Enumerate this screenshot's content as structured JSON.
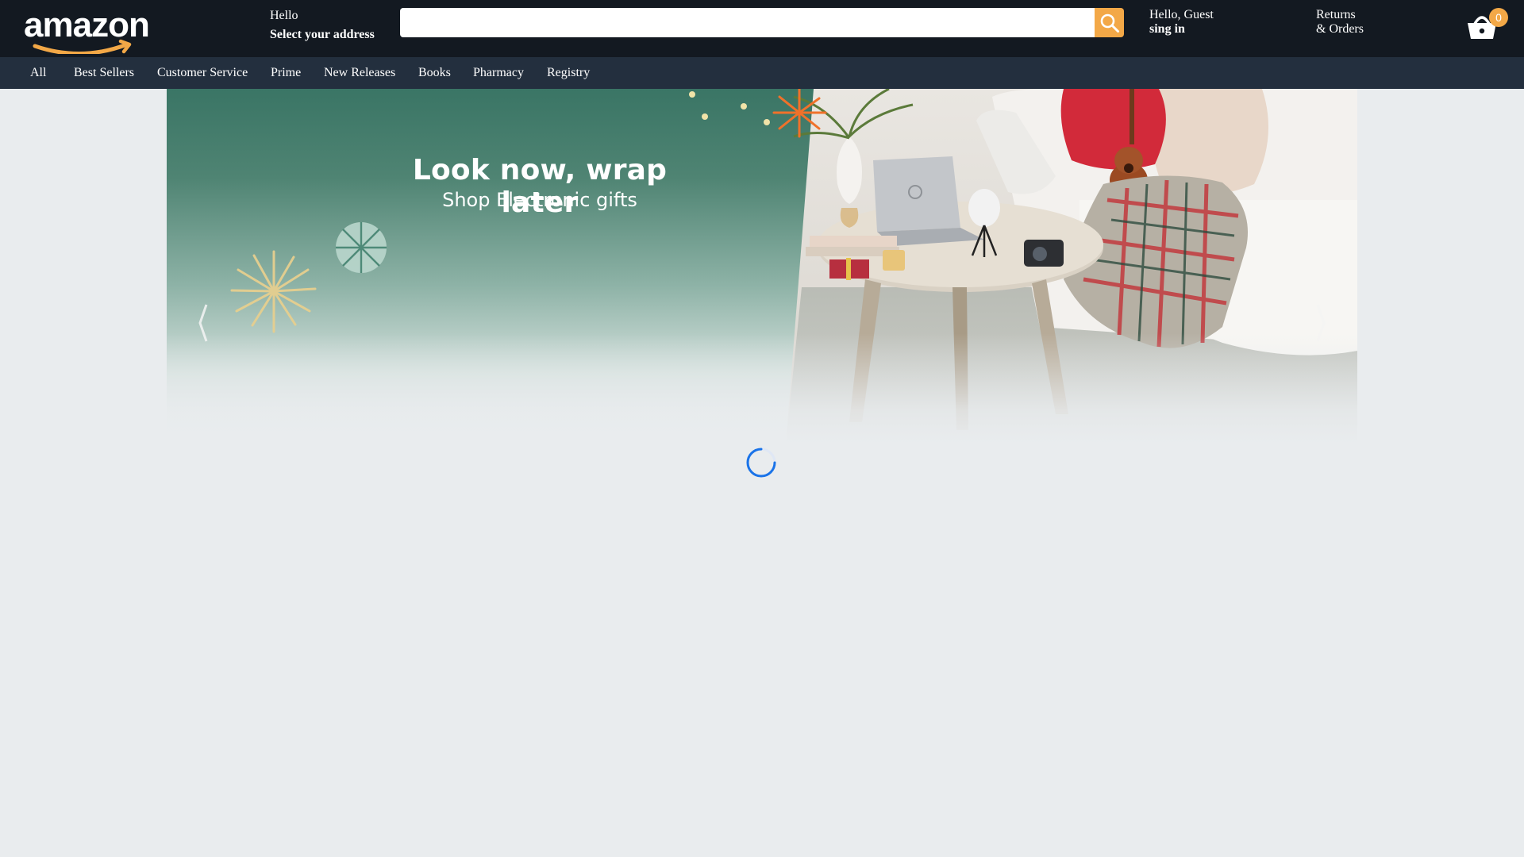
{
  "header": {
    "logo_text": "amazon",
    "address": {
      "hello": "Hello",
      "select": "Select your address"
    },
    "search": {
      "placeholder": "",
      "value": ""
    },
    "account": {
      "greeting": "Hello, Guest",
      "action": "sing in"
    },
    "returns": {
      "line1": "Returns",
      "line2": "& Orders"
    },
    "cart": {
      "count": "0"
    }
  },
  "nav": {
    "items": [
      "All",
      "Best Sellers",
      "Customer Service",
      "Prime",
      "New Releases",
      "Books",
      "Pharmacy",
      "Registry"
    ]
  },
  "hero": {
    "title": "Look now, wrap later",
    "subtitle": "Shop Electronic gifts"
  },
  "colors": {
    "topbar": "#131921",
    "navbar": "#232f3e",
    "accent": "#f3a847",
    "page_bg": "#e9ecee",
    "spinner": "#1a73e8"
  },
  "icons": {
    "search": "search-icon",
    "cart": "basket-icon",
    "spinner": "loading-spinner-icon"
  }
}
